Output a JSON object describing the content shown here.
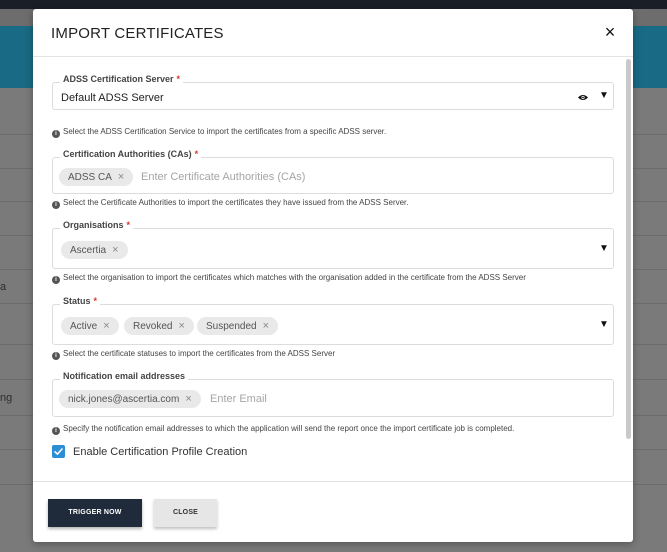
{
  "background": {
    "fragments": [
      "a",
      "ng"
    ]
  },
  "modal": {
    "title": "IMPORT CERTIFICATES",
    "close_glyph": "×"
  },
  "fields": {
    "server": {
      "label": "ADSS Certification Server",
      "required_mark": "*",
      "value": "Default ADSS Server",
      "help": "Select the ADSS Certification Service to import the certificates from a specific ADSS server."
    },
    "cas": {
      "label": "Certification Authorities (CAs)",
      "required_mark": "*",
      "chips": [
        "ADSS CA"
      ],
      "placeholder": "Enter Certificate Authorities (CAs)",
      "help": "Select the Certificate Authorities to import the certificates they have issued from the ADSS Server."
    },
    "organisations": {
      "label": "Organisations",
      "required_mark": "*",
      "chips": [
        "Ascertia"
      ],
      "help": "Select the organisation to import the certificates which matches with the organisation added in the certificate from the ADSS Server"
    },
    "status": {
      "label": "Status",
      "required_mark": "*",
      "chips": [
        "Active",
        "Revoked",
        "Suspended"
      ],
      "help": "Select the certificate statuses to import the certificates from the ADSS Server"
    },
    "emails": {
      "label": "Notification email addresses",
      "chips": [
        "nick.jones@ascertia.com"
      ],
      "placeholder": "Enter Email",
      "help": "Specify the notification email addresses to which the application will send the report once the import certificate job is completed."
    }
  },
  "checkbox": {
    "label": "Enable Certification Profile Creation",
    "checked": true
  },
  "footer": {
    "trigger_label": "TRIGGER NOW",
    "close_label": "CLOSE"
  },
  "icons": {
    "info": "i",
    "chip_remove": "×",
    "dropdown": "▼"
  },
  "colors": {
    "header_bg": "#196a84",
    "primary_button": "#1f2a3a",
    "checkbox": "#2c8fd6",
    "required": "#d9342b"
  }
}
